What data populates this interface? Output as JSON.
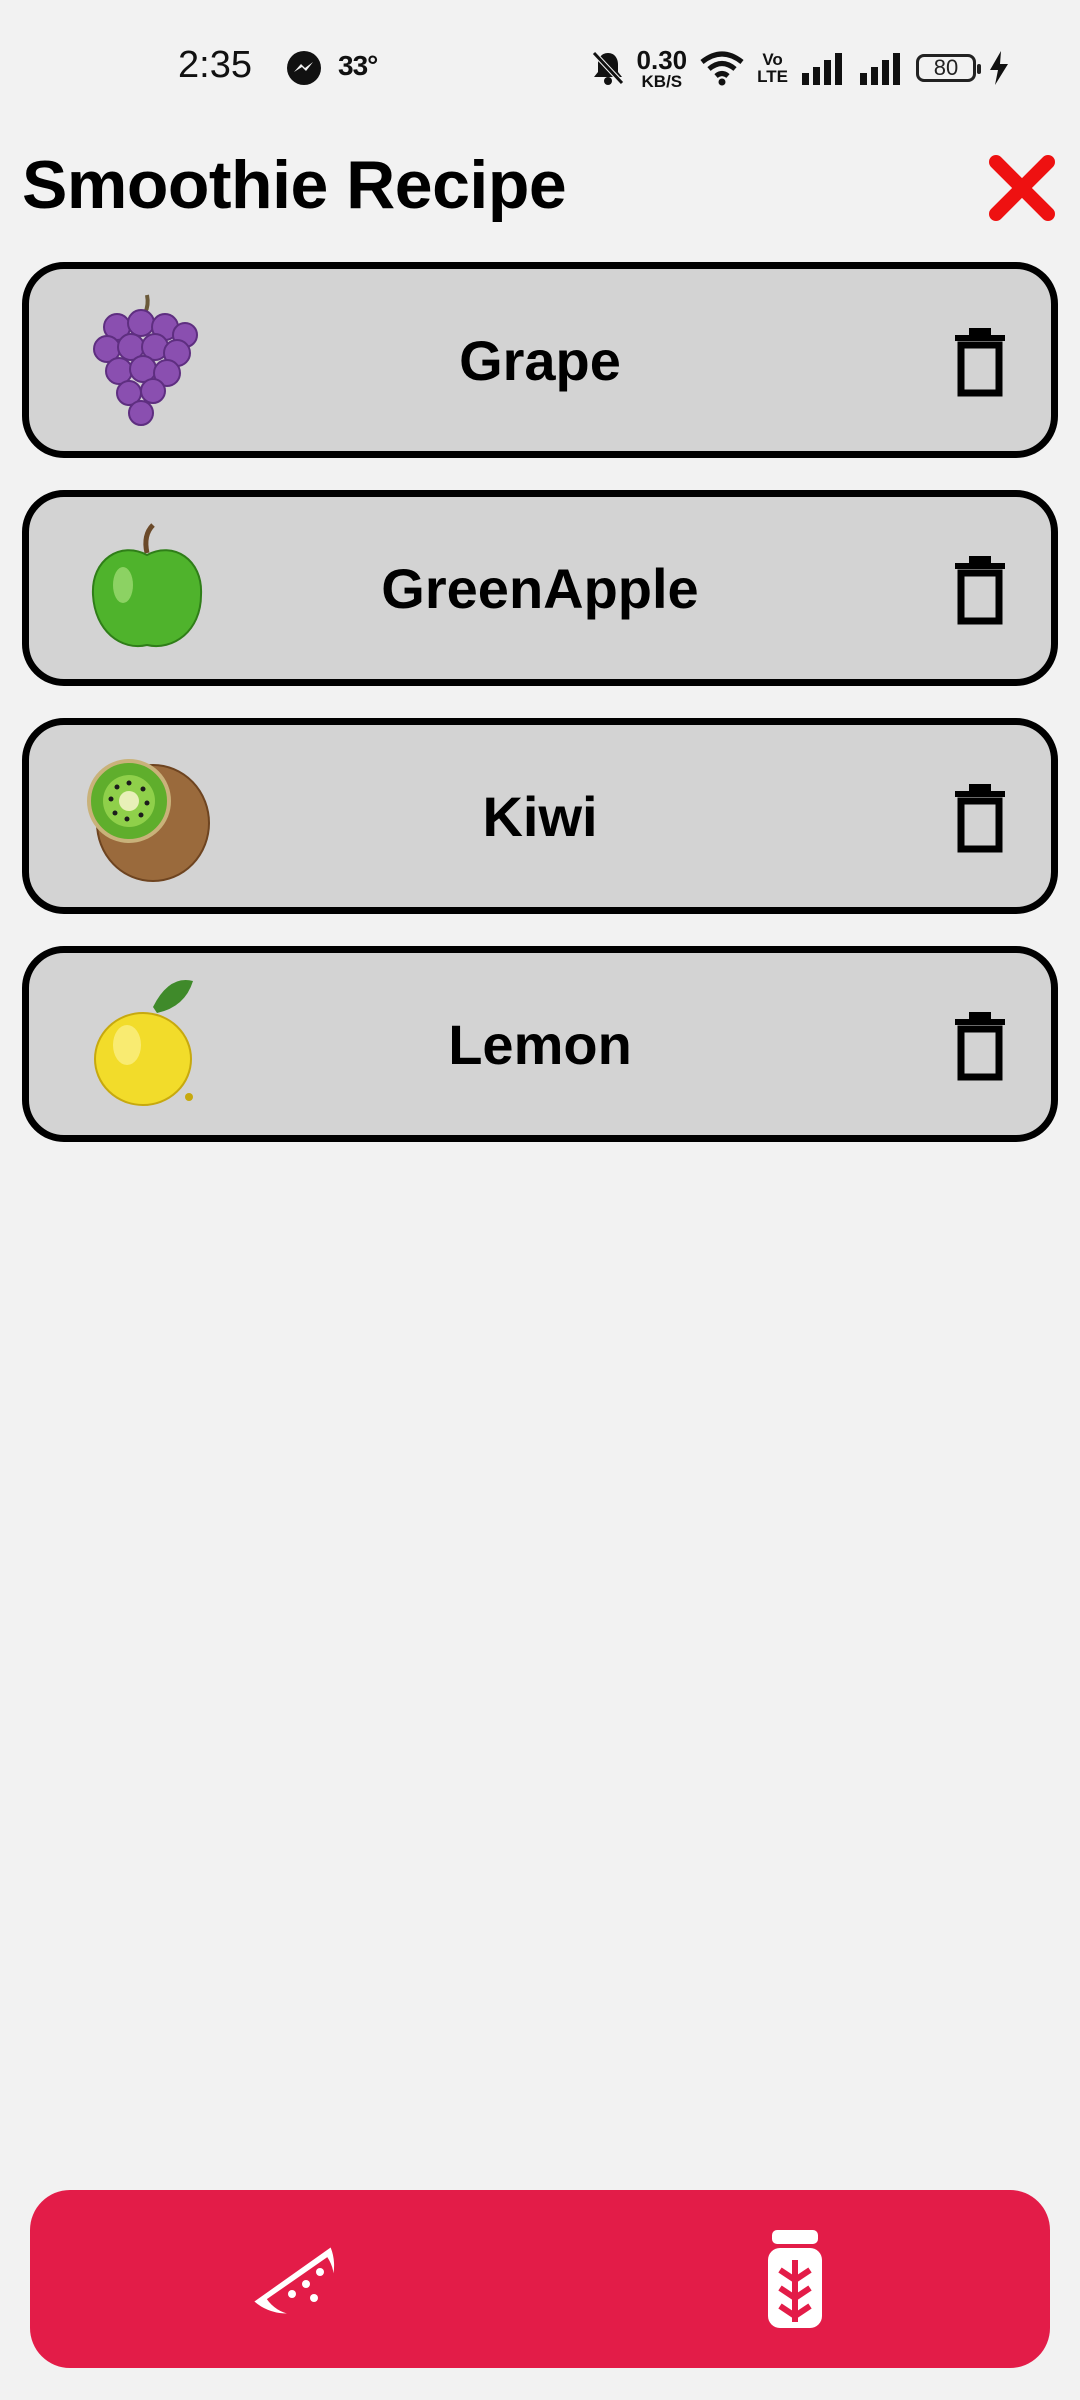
{
  "status_bar": {
    "time": "2:35",
    "temperature": "33°",
    "net_speed_value": "0.30",
    "net_speed_unit": "KB/S",
    "volte_label": "Vo\nLTE",
    "battery_level": "80"
  },
  "header": {
    "title": "Smoothie Recipe",
    "close_icon": "close-icon",
    "close_color": "#ee1111"
  },
  "ingredients": [
    {
      "name": "Grape",
      "icon": "grape-icon"
    },
    {
      "name": "GreenApple",
      "icon": "green-apple-icon"
    },
    {
      "name": "Kiwi",
      "icon": "kiwi-icon"
    },
    {
      "name": "Lemon",
      "icon": "lemon-icon"
    }
  ],
  "bottom_nav": {
    "background": "#e31c48",
    "items": [
      {
        "icon": "watermelon-icon"
      },
      {
        "icon": "smoothie-jar-icon"
      }
    ]
  },
  "colors": {
    "background": "#f2f2f2",
    "card_background": "#d3d3d3",
    "card_border": "#000000"
  }
}
